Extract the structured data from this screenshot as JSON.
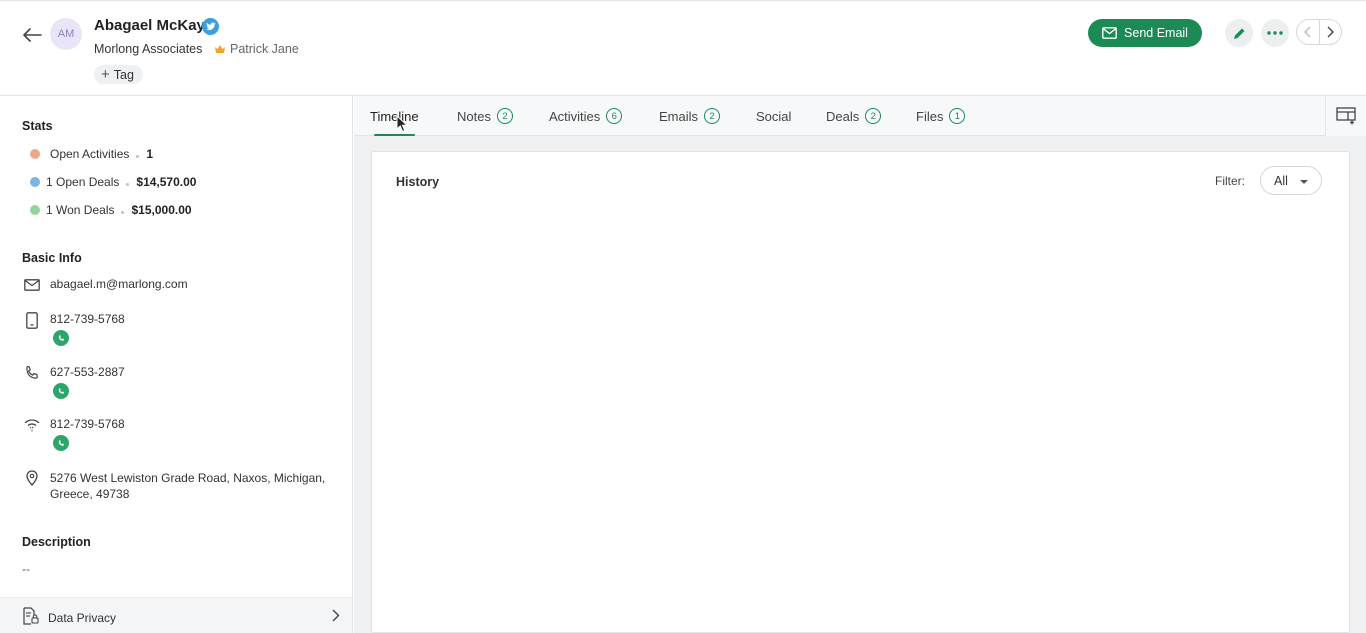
{
  "contact": {
    "initials": "AM",
    "name": "Abagael McKay",
    "company": "Morlong Associates",
    "owner": "Patrick Jane",
    "tag_label": "Tag"
  },
  "actions": {
    "send_email_label": "Send Email"
  },
  "stats": {
    "title": "Stats",
    "items": [
      {
        "label": "Open Activities",
        "value": "1",
        "color": "#e8a98c"
      },
      {
        "label": "1 Open Deals",
        "value": "$14,570.00",
        "color": "#79b4e3"
      },
      {
        "label": "1 Won Deals",
        "value": "$15,000.00",
        "color": "#93d39c"
      }
    ]
  },
  "basic_info": {
    "title": "Basic Info",
    "email": "abagael.m@marlong.com",
    "mobile": "812-739-5768",
    "phone": "627-553-2887",
    "other_phone": "812-739-5768",
    "address": "5276 West Lewiston Grade Road, Naxos, Michigan, Greece, 49738"
  },
  "description": {
    "title": "Description",
    "value": "--"
  },
  "data_privacy": {
    "label": "Data Privacy"
  },
  "tabs": [
    {
      "label": "Timeline",
      "count": null,
      "active": true
    },
    {
      "label": "Notes",
      "count": "2"
    },
    {
      "label": "Activities",
      "count": "6"
    },
    {
      "label": "Emails",
      "count": "2"
    },
    {
      "label": "Social",
      "count": null
    },
    {
      "label": "Deals",
      "count": "2"
    },
    {
      "label": "Files",
      "count": "1"
    }
  ],
  "timeline": {
    "history_title": "History",
    "filter_label": "Filter:",
    "filter_value": "All"
  },
  "colors": {
    "accent": "#1b8a55",
    "twitter": "#3aa0dd",
    "whatsapp": "#2ca56b"
  }
}
